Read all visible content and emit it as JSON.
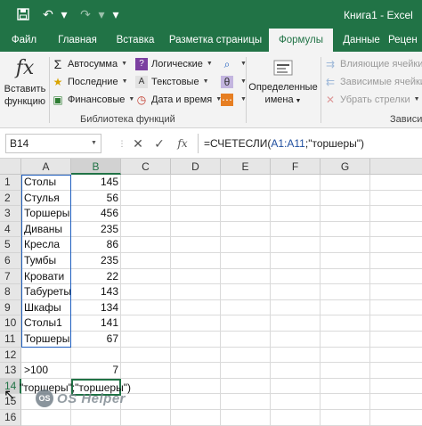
{
  "window": {
    "title": "Книга1 - Excel"
  },
  "quick_access": {
    "save_icon": "💾",
    "undo_icon": "↶",
    "redo_icon": "↷",
    "dropdown_glyph": "▾",
    "customize_glyph": "▾"
  },
  "tabs": [
    {
      "label": "Файл"
    },
    {
      "label": "Главная"
    },
    {
      "label": "Вставка"
    },
    {
      "label": "Разметка страницы"
    },
    {
      "label": "Формулы",
      "active": true
    },
    {
      "label": "Данные"
    },
    {
      "label": "Рецен"
    }
  ],
  "ribbon": {
    "insert_function": {
      "icon": "fx",
      "label_line1": "Вставить",
      "label_line2": "функцию"
    },
    "library_items": [
      {
        "icon": "Σ",
        "label": "Автосумма"
      },
      {
        "icon": "★",
        "label": "Последние"
      },
      {
        "icon": "▣",
        "label": "Финансовые"
      },
      {
        "icon": "?",
        "label": "Логические"
      },
      {
        "icon": "A",
        "label": "Текстовые"
      },
      {
        "icon": "◷",
        "label": "Дата и время"
      }
    ],
    "library_extra_icons": [
      "⌕",
      "θ",
      "⋯"
    ],
    "library_group_label": "Библиотека функций",
    "defined_names": {
      "label_line1": "Определенные",
      "label_line2": "имена"
    },
    "audit_items": [
      {
        "label": "Влияющие ячейки"
      },
      {
        "label": "Зависимые ячейки"
      },
      {
        "label": "Убрать стрелки"
      }
    ],
    "audit_group_label": "Зависи",
    "colors": {
      "accent": "#217346"
    }
  },
  "formula_bar": {
    "name_box": "B14",
    "cancel_icon": "✕",
    "enter_icon": "✓",
    "fx_label": "fx",
    "formula_prefix": "=СЧЕТЕСЛИ(",
    "formula_ref": "A1:A11",
    "formula_suffix": ";\"торшеры\")"
  },
  "sheet": {
    "columns": [
      "A",
      "B",
      "C",
      "D",
      "E",
      "F",
      "G"
    ],
    "rows": [
      "1",
      "2",
      "3",
      "4",
      "5",
      "6",
      "7",
      "8",
      "9",
      "10",
      "11",
      "12",
      "13",
      "14",
      "15",
      "16"
    ],
    "data": [
      {
        "a": "Столы",
        "b": "145"
      },
      {
        "a": "Стулья",
        "b": "56"
      },
      {
        "a": "Торшеры",
        "b": "456"
      },
      {
        "a": "Диваны",
        "b": "235"
      },
      {
        "a": "Кресла",
        "b": "86"
      },
      {
        "a": "Тумбы",
        "b": "235"
      },
      {
        "a": "Кровати",
        "b": "22"
      },
      {
        "a": "Табуреты",
        "b": "143"
      },
      {
        "a": "Шкафы",
        "b": "134"
      },
      {
        "a": "Столы1",
        "b": "141"
      },
      {
        "a": "Торшеры",
        "b": "67"
      }
    ],
    "row13": {
      "a": ">100",
      "b": "7"
    },
    "editing_text": "\"торшеры\";\"торшеры\")",
    "selected_column": "B",
    "selected_row": "14"
  },
  "watermark": {
    "logo": "OS",
    "text": "OS Helper"
  }
}
